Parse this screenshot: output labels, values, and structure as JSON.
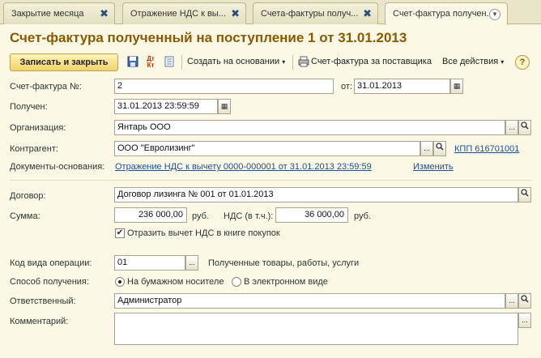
{
  "tabs": [
    {
      "label": "Закрытие месяца",
      "close": "✖"
    },
    {
      "label": "Отражение НДС к вы...",
      "close": "✖"
    },
    {
      "label": "Счета-фактуры получ...",
      "close": "✖"
    },
    {
      "label": "Счет-фактура получен...",
      "dropdown": "▼"
    }
  ],
  "title": "Счет-фактура полученный на поступление 1 от 31.01.2013",
  "toolbar": {
    "save_close": "Записать и закрыть",
    "create_basis": "Создать на основании",
    "invoice_supplier": "Счет-фактура за поставщика",
    "all_actions": "Все действия",
    "help": "?",
    "dtkt_icon_text": "Дт Кт"
  },
  "form": {
    "invoice_no_label": "Счет-фактура №:",
    "invoice_no_value": "2",
    "from_label": "от:",
    "from_value": "31.01.2013",
    "received_label": "Получен:",
    "received_value": "31.01.2013 23:59:59",
    "org_label": "Организация:",
    "org_value": "Янтарь ООО",
    "contractor_label": "Контрагент:",
    "contractor_value": "ООО \"Евролизинг\"",
    "kpp_link": "КПП 616701001",
    "docs_label": "Документы-основания:",
    "docs_link": "Отражение НДС к вычету 0000-000001 от 31.01.2013 23:59:59",
    "change_link": "Изменить",
    "contract_label": "Договор:",
    "contract_value": "Договор лизинга № 001 от 01.01.2013",
    "sum_label": "Сумма:",
    "sum_value": "236 000,00",
    "currency1": "руб.",
    "vat_label": "НДС (в т.ч.):",
    "vat_value": "36 000,00",
    "currency2": "руб.",
    "reflect_vat_label": "Отразить вычет НДС в книге покупок",
    "reflect_vat_checked": "✔",
    "op_code_label": "Код вида операции:",
    "op_code_value": "01",
    "op_code_desc": "Полученные товары, работы, услуги",
    "method_label": "Способ получения:",
    "method_paper": "На бумажном носителе",
    "method_electronic": "В электронном виде",
    "responsible_label": "Ответственный:",
    "responsible_value": "Администратор",
    "comment_label": "Комментарий:",
    "comment_value": ""
  },
  "icons": {
    "ellipsis": "...",
    "search": "🔍"
  }
}
